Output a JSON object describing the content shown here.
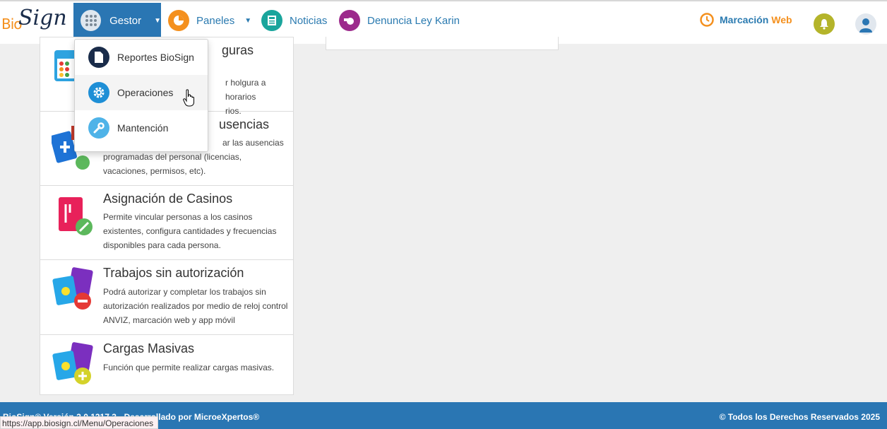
{
  "brand": {
    "logo_part1": "Bio",
    "logo_part2": "Sign"
  },
  "nav": {
    "gestor": "Gestor",
    "paneles": "Paneles",
    "noticias": "Noticias",
    "denuncia": "Denuncia Ley Karin",
    "marcacion_label": "Marcación",
    "marcacion_web": "Web"
  },
  "dropdown": {
    "items": [
      {
        "label": "Reportes BioSign",
        "icon": "document-icon"
      },
      {
        "label": "Operaciones",
        "icon": "gear-icon"
      },
      {
        "label": "Mantención",
        "icon": "wrench-icon"
      }
    ]
  },
  "cards": [
    {
      "title": "guras",
      "desc_line1": "r holgura a horarios",
      "desc_line2": "rios."
    },
    {
      "title": "usencias",
      "desc_line1": "ar las ausencias",
      "desc": "programadas del personal (licencias, vacaciones, permisos, etc)."
    },
    {
      "title": "Asignación de Casinos",
      "desc": "Permite vincular personas a los casinos existentes, configura cantidades y frecuencias disponibles para cada persona."
    },
    {
      "title": "Trabajos sin autorización",
      "desc": "Podrá autorizar y completar los trabajos sin autorización realizados por medio de reloj control ANVIZ, marcación web y app móvil"
    },
    {
      "title": "Cargas Masivas",
      "desc": "Función que permite realizar cargas masivas."
    }
  ],
  "footer": {
    "left": "BioSign© Versión 3.0.1317.3 - Desarrollado por MicroeXpertos®",
    "right": "© Todos los Derechos Reservados 2025"
  },
  "status_url": "https://app.biosign.cl/Menu/Operaciones",
  "colors": {
    "primary": "#2a76b3",
    "accent": "#f4901e",
    "bell": "#b4b42a"
  }
}
